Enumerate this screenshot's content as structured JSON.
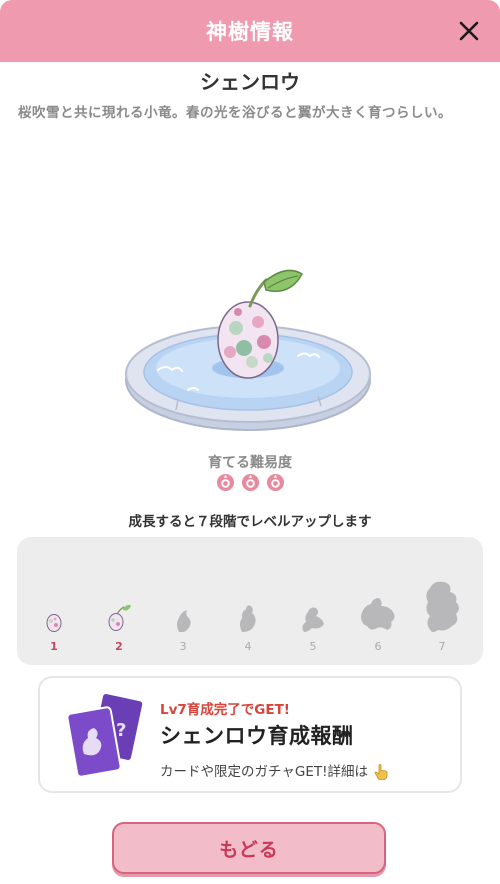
{
  "header": {
    "title": "神樹情報",
    "close_icon": "close-icon"
  },
  "creature": {
    "name": "シェンロウ",
    "description": "桜吹雪と共に現れる小竜。春の光を浴びると翼が大きく育つらしい。"
  },
  "difficulty": {
    "label": "育てる難易度",
    "level": 3,
    "icon": "sprout-badge-icon",
    "color": "#e8899e"
  },
  "growth": {
    "text": "成長すると７段階でレベルアップします",
    "current_stage": 2,
    "stages": [
      {
        "num": "1",
        "icon": "egg-icon",
        "unlocked": true
      },
      {
        "num": "2",
        "icon": "sprouted-egg-icon",
        "unlocked": true
      },
      {
        "num": "3",
        "icon": "silhouette-stage3-icon",
        "unlocked": false
      },
      {
        "num": "4",
        "icon": "silhouette-stage4-icon",
        "unlocked": false
      },
      {
        "num": "5",
        "icon": "silhouette-stage5-icon",
        "unlocked": false
      },
      {
        "num": "6",
        "icon": "silhouette-stage6-icon",
        "unlocked": false
      },
      {
        "num": "7",
        "icon": "silhouette-stage7-icon",
        "unlocked": false
      }
    ]
  },
  "reward": {
    "subtitle": "Lv7育成完了でGET!",
    "title": "シェンロウ育成報酬",
    "description": "カードや限定のガチャGET!詳細は",
    "icon": "pointing-hand-icon"
  },
  "footer": {
    "back_label": "もどる"
  },
  "colors": {
    "header_bg": "#ef9aae",
    "accent": "#c0485f",
    "reward_sub": "#d9433a"
  }
}
